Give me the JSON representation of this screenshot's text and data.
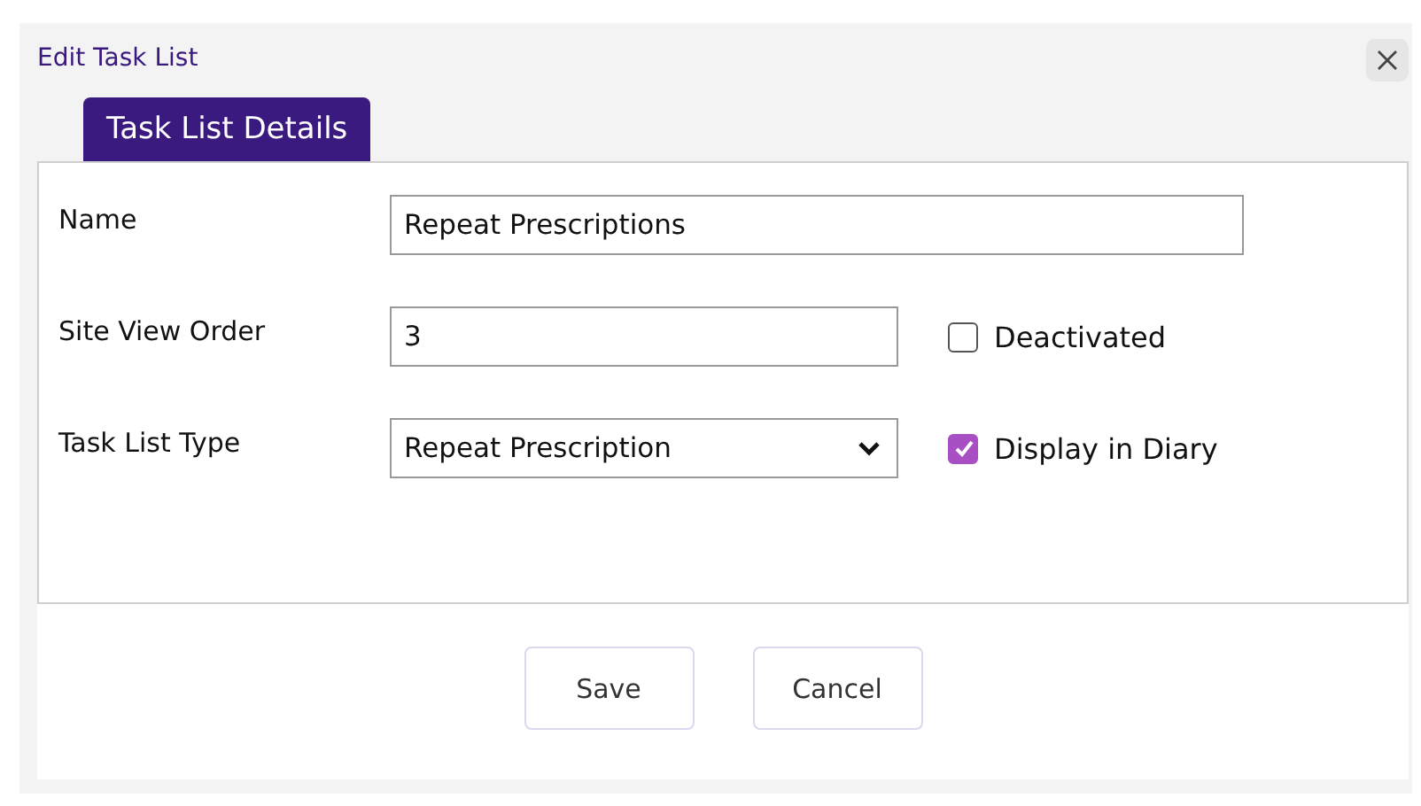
{
  "dialog": {
    "title": "Edit Task List"
  },
  "tabs": [
    {
      "label": "Task List Details",
      "selected": true
    }
  ],
  "fields": [
    {
      "kind": "wide",
      "label": "Name",
      "value": "Repeat Prescriptions"
    },
    {
      "kind": "text",
      "label": "Site View Order",
      "value": "3",
      "checkbox": {
        "label": "Deactivated",
        "checked": false
      }
    },
    {
      "kind": "select",
      "label": "Task List Type",
      "value": "Repeat Prescription",
      "checkbox": {
        "label": "Display in Diary",
        "checked": true
      }
    }
  ],
  "buttons": [
    "Save",
    "Cancel"
  ]
}
